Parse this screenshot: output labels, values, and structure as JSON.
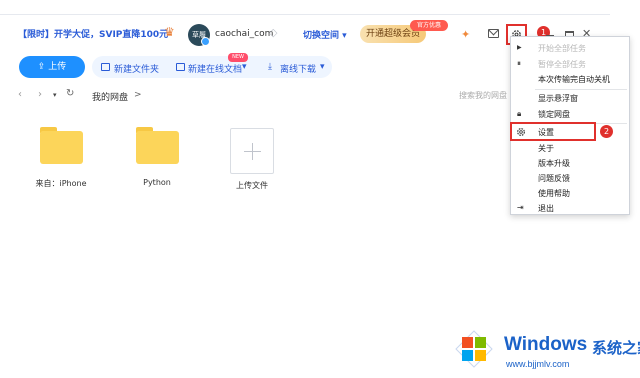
{
  "header": {
    "promo_text": "【限时】开学大促，SVIP直降100元",
    "avatar_text": "草履",
    "username": "caochai_com",
    "switch_space": "切换空间 ▾",
    "vip_button": "开通超级会员",
    "vip_tag": "官方优惠",
    "annotation_1": "1"
  },
  "toolbar": {
    "upload": "上传",
    "new_folder": "新建文件夹",
    "new_online_doc": "新建在线文档",
    "new_tag": "NEW",
    "offline_download": "离线下载"
  },
  "nav": {
    "crumb": "我的网盘",
    "separator": ">",
    "search_placeholder": "搜索我的网盘"
  },
  "files": [
    {
      "name": "来自：iPhone",
      "type": "folder"
    },
    {
      "name": "Python",
      "type": "folder"
    },
    {
      "name": "上传文件",
      "type": "upload"
    }
  ],
  "menu": {
    "items": [
      {
        "label": "开始全部任务",
        "disabled": true
      },
      {
        "label": "暂停全部任务",
        "disabled": true
      },
      {
        "label": "本次传输完自动关机",
        "disabled": false
      },
      {
        "label": "显示悬浮窗",
        "disabled": false
      },
      {
        "label": "锁定网盘",
        "disabled": false
      },
      {
        "label": "设置",
        "disabled": false
      },
      {
        "label": "关于",
        "disabled": false
      },
      {
        "label": "版本升级",
        "disabled": false
      },
      {
        "label": "问题反馈",
        "disabled": false
      },
      {
        "label": "使用帮助",
        "disabled": false
      },
      {
        "label": "退出",
        "disabled": false
      }
    ],
    "annotation_2": "2"
  },
  "watermark": {
    "title": "Windows",
    "title_cn": "系统之家",
    "url": "www.bjjmlv.com"
  },
  "colors": {
    "accent": "#1e90ff",
    "highlight": "#e0302c",
    "folder": "#fcd55a"
  }
}
